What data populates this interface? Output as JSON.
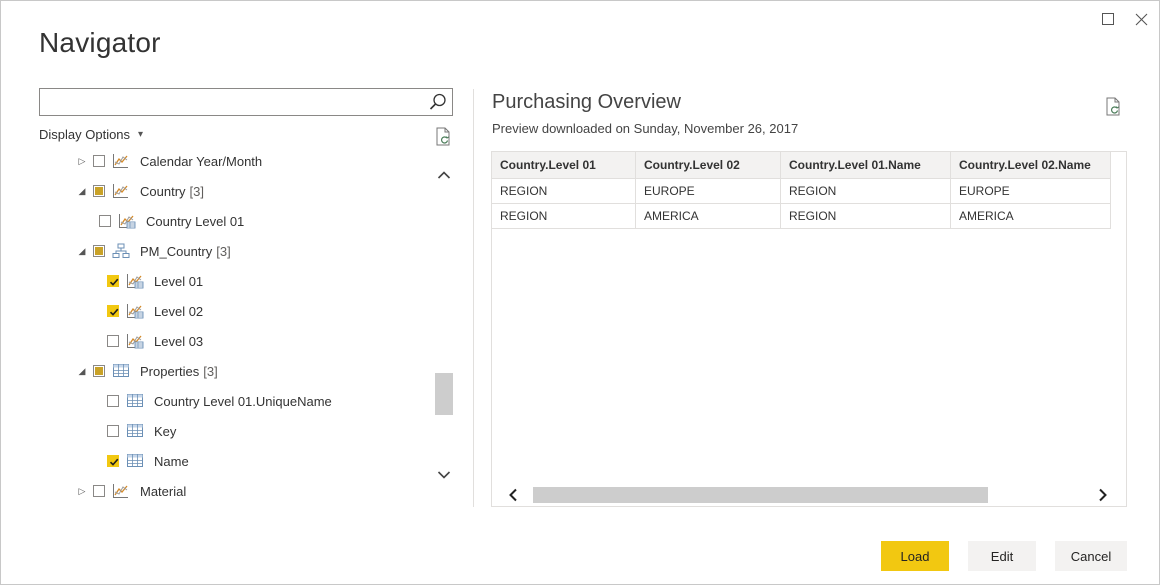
{
  "window": {
    "title": "Navigator"
  },
  "search": {
    "value": "",
    "placeholder": ""
  },
  "display_options": {
    "label": "Display Options",
    "chevron": "▾"
  },
  "tree": {
    "items": [
      {
        "label": "Calendar Year/Month",
        "count": "",
        "expander": "▷",
        "state": "unchecked",
        "icon": "chart-icon"
      },
      {
        "label": "Country",
        "count": "[3]",
        "expander": "◢",
        "state": "partial",
        "icon": "chart-icon"
      },
      {
        "label": "Country Level 01",
        "count": "",
        "expander": "",
        "state": "unchecked",
        "icon": "chart-table-icon"
      },
      {
        "label": "PM_Country",
        "count": "[3]",
        "expander": "◢",
        "state": "partial",
        "icon": "hierarchy-icon"
      },
      {
        "label": "Level 01",
        "count": "",
        "expander": "",
        "state": "checked",
        "icon": "chart-table-icon"
      },
      {
        "label": "Level 02",
        "count": "",
        "expander": "",
        "state": "checked",
        "icon": "chart-table-icon"
      },
      {
        "label": "Level 03",
        "count": "",
        "expander": "",
        "state": "unchecked",
        "icon": "chart-table-icon"
      },
      {
        "label": "Properties",
        "count": "[3]",
        "expander": "◢",
        "state": "partial",
        "icon": "table-icon"
      },
      {
        "label": "Country Level 01.UniqueName",
        "count": "",
        "expander": "",
        "state": "unchecked",
        "icon": "table-icon"
      },
      {
        "label": "Key",
        "count": "",
        "expander": "",
        "state": "unchecked",
        "icon": "table-icon"
      },
      {
        "label": "Name",
        "count": "",
        "expander": "",
        "state": "checked",
        "icon": "table-icon"
      },
      {
        "label": "Material",
        "count": "",
        "expander": "▷",
        "state": "unchecked",
        "icon": "chart-icon"
      }
    ]
  },
  "preview": {
    "title": "Purchasing Overview",
    "subtitle": "Preview downloaded on Sunday, November 26, 2017",
    "columns": [
      "Country.Level 01",
      "Country.Level 02",
      "Country.Level 01.Name",
      "Country.Level 02.Name"
    ],
    "rows": [
      [
        "REGION",
        "EUROPE",
        "REGION",
        "EUROPE"
      ],
      [
        "REGION",
        "AMERICA",
        "REGION",
        "AMERICA"
      ]
    ]
  },
  "buttons": {
    "load": "Load",
    "edit": "Edit",
    "cancel": "Cancel"
  },
  "colors": {
    "accent": "#f2c811",
    "partial": "#c9a227",
    "button_gray": "#f3f2f1"
  }
}
